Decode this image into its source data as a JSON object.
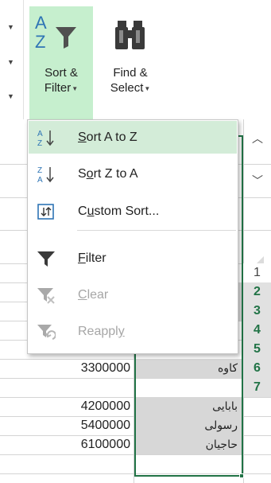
{
  "ribbon": {
    "sort_filter": {
      "line1": "Sort &",
      "line2": "Filter",
      "icon": "sort-filter-az-funnel-icon"
    },
    "find_select": {
      "line1": "Find &",
      "line2": "Select",
      "icon": "binoculars-icon"
    }
  },
  "menu": {
    "items": [
      {
        "label": "Sort A to Z",
        "accel_char": "S",
        "accel_index": 0,
        "icon": "sort-ascending-icon",
        "highlighted": true,
        "enabled": true
      },
      {
        "label": "Sort Z to A",
        "accel_char": "o",
        "accel_index": 1,
        "icon": "sort-descending-icon",
        "highlighted": false,
        "enabled": true
      },
      {
        "label": "Custom Sort...",
        "accel_char": "u",
        "accel_index": 1,
        "icon": "custom-sort-icon",
        "highlighted": false,
        "enabled": true
      },
      {
        "label": "Filter",
        "accel_char": "F",
        "accel_index": 0,
        "icon": "filter-funnel-icon",
        "highlighted": false,
        "enabled": true
      },
      {
        "label": "Clear",
        "accel_char": "C",
        "accel_index": 0,
        "icon": "clear-filter-icon",
        "highlighted": false,
        "enabled": false
      },
      {
        "label": "Reapply",
        "accel_char": "y",
        "accel_index": 6,
        "icon": "reapply-filter-icon",
        "highlighted": false,
        "enabled": false
      }
    ]
  },
  "sheet": {
    "row_headers": [
      "1",
      "2",
      "3",
      "4",
      "5",
      "6",
      "7"
    ],
    "rows": [
      {
        "row": "4",
        "amount": "3300000",
        "name": "کاوه"
      },
      {
        "row": "5",
        "amount": "4200000",
        "name": "بابایی"
      },
      {
        "row": "6",
        "amount": "5400000",
        "name": "رسولی"
      },
      {
        "row": "7",
        "amount": "6100000",
        "name": "حاجیان"
      }
    ]
  },
  "scroll": {
    "up_icon": "chevron-up-icon",
    "down_icon": "chevron-down-icon"
  },
  "colors": {
    "accent_green": "#217346",
    "highlight_green": "#c6efce",
    "menu_hover": "#d3ecd8",
    "selection_gray": "#d7d7d7",
    "disabled_text": "#a6a6a6"
  }
}
